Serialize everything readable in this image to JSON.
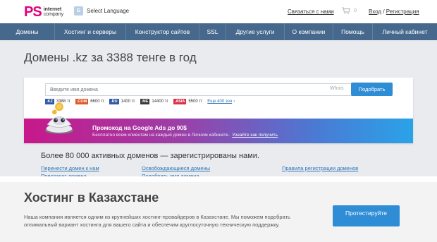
{
  "header": {
    "logo_text": "PS",
    "logo_line1": "internet",
    "logo_line2": "company",
    "language_label": "Select Language",
    "contact_label": "Связаться с нами",
    "cart_count": "0",
    "login_label": "Вход",
    "login_separator": " / ",
    "register_label": "Регистрация"
  },
  "nav": {
    "items": [
      {
        "label": "Домены"
      },
      {
        "label": "Хостинг и серверы"
      },
      {
        "label": "Конструктор сайтов"
      },
      {
        "label": "SSL"
      },
      {
        "label": "Другие услуги"
      },
      {
        "label": "О компании"
      },
      {
        "label": "Помощь"
      },
      {
        "label": "Личный кабинет"
      }
    ]
  },
  "domains": {
    "title": "Домены .kz за 3388 тенге в год",
    "search_placeholder": "Введите имя домена",
    "whois_label": "Whois",
    "search_button": "Подобрать",
    "zones": [
      {
        "tag": ".KZ",
        "price": "3388 тг",
        "color": "#2e5aa8"
      },
      {
        "tag": ".COM",
        "price": "6600 тг",
        "color": "#e05a2a"
      },
      {
        "tag": ".RU",
        "price": "1400 тг",
        "color": "#2e5aa8"
      },
      {
        "tag": ".ME",
        "price": "14400 тг",
        "color": "#3a3a3a"
      },
      {
        "tag": ".ASIA",
        "price": "5500 тг",
        "color": "#d8334a"
      }
    ],
    "more_zones": "Еще 400 зон",
    "promo_title": "Промокод на Google Ads до 90$",
    "promo_text": "Бесплатно всем клиентам на каждый домен в Личном кабинете",
    "promo_link": "Узнайте как получить",
    "stats_text": "Более 80 000 активных доменов — зарегистрированы нами.",
    "links": {
      "transfer": "Перенести домен к нам",
      "released": "Освобождающиеся домены",
      "rules": "Правила регистрации доменов",
      "preorder": "Предзаказ домена",
      "suggest": "Подобрать имя домена"
    }
  },
  "hosting": {
    "title": "Хостинг в Казахстане",
    "text": "Наша компания является одним из крупнейших хостинг-провайдеров в Казахстане. Мы поможем подобрать оптимальный вариант хостинга для вашего сайта и обеспечим круглосуточную техническую поддержку.",
    "button_label": "Протестируйте"
  },
  "colors": {
    "nav_bg": "#46688c",
    "accent_blue": "#2f8dd6",
    "logo_pink": "#e2007a",
    "link_blue": "#2e75b6"
  }
}
